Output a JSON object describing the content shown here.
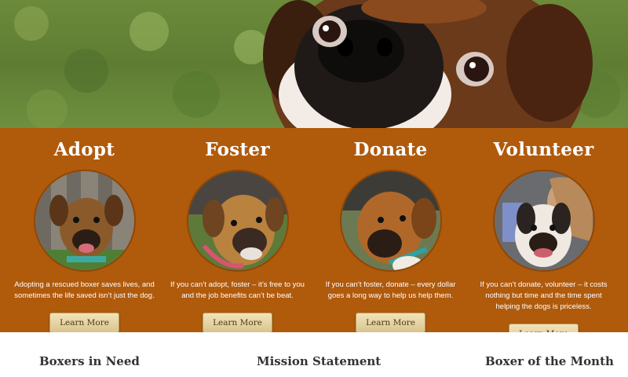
{
  "hero": {
    "image": "boxer-closeup-photo"
  },
  "features": [
    {
      "title": "Adopt",
      "text": "Adopting a rescued boxer saves lives, and sometimes the life saved isn’t just the dog.",
      "button": "Learn More",
      "image": "boxer-fawn-fence-photo"
    },
    {
      "title": "Foster",
      "text": "If you can’t adopt, foster – it’s free to you and the job benefits can’t be beat.",
      "button": "Learn More",
      "image": "boxer-fawn-grass-photo"
    },
    {
      "title": "Donate",
      "text": "If you can’t foster, donate – every dollar goes a long way to help us help them.",
      "button": "Learn More",
      "image": "boxer-brown-collar-photo"
    },
    {
      "title": "Volunteer",
      "text": "If you can’t donate, volunteer – it costs nothing but time and the time spent helping the dogs is priceless.",
      "button": "Learn More",
      "image": "boxer-with-girl-photo"
    }
  ],
  "sections": {
    "boxers_in_need": "Boxers in Need",
    "mission_statement": "Mission Statement",
    "boxer_of_month": "Boxer of the Month"
  },
  "colors": {
    "band": "#b05a0c",
    "button": "#e6d3a0",
    "heading": "#333333"
  }
}
